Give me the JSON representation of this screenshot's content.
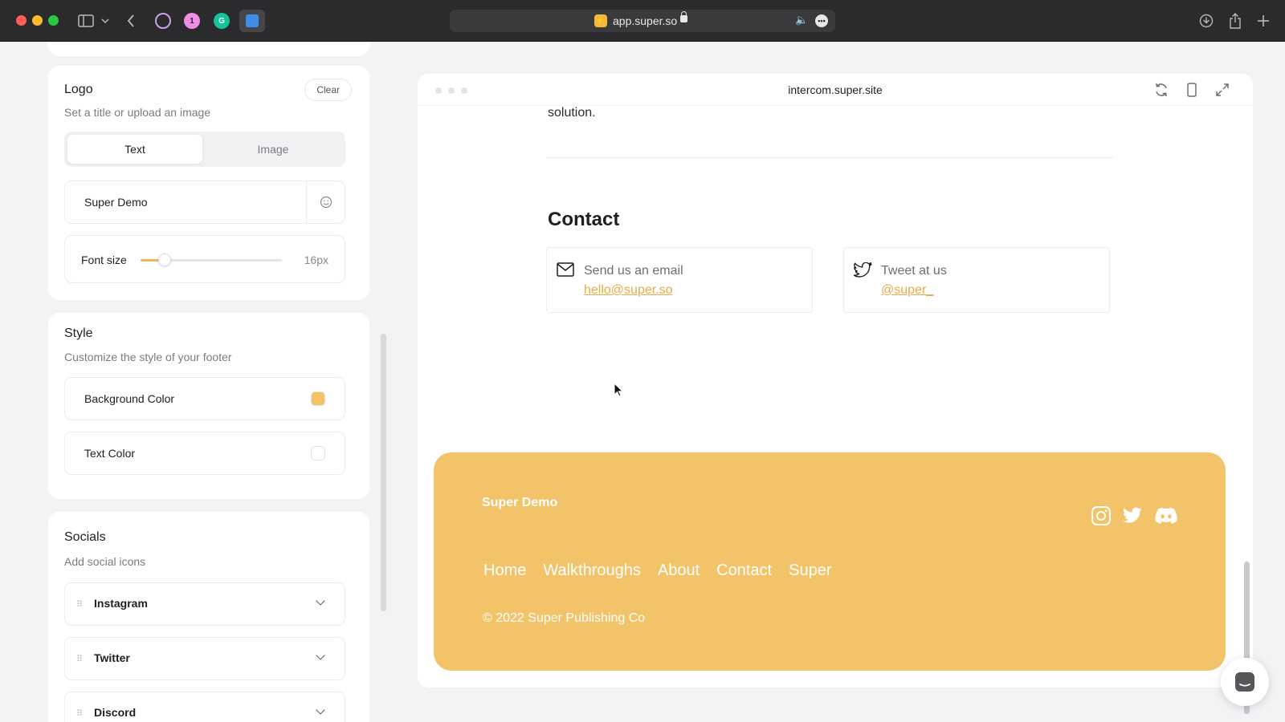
{
  "browser": {
    "url": "app.super.so"
  },
  "editor": {
    "logo": {
      "title": "Logo",
      "subtitle": "Set a title or upload an image",
      "clear_label": "Clear",
      "tabs": [
        "Text",
        "Image"
      ],
      "active_tab": "Text",
      "text_value": "Super Demo",
      "font_size_label": "Font size",
      "font_size_value": "16px",
      "font_size_fraction": 0.16
    },
    "style": {
      "title": "Style",
      "subtitle": "Customize the style of your footer",
      "background_label": "Background Color",
      "background_color": "#f3c369",
      "text_color_label": "Text Color",
      "text_color": "#ffffff"
    },
    "socials": {
      "title": "Socials",
      "subtitle": "Add social icons",
      "items": [
        "Instagram",
        "Twitter",
        "Discord"
      ]
    }
  },
  "preview": {
    "url": "intercom.super.site",
    "partial_text": "solution.",
    "contact_heading": "Contact",
    "email_card": {
      "title": "Send us an email",
      "link": "hello@super.so",
      "icon": "mail-icon"
    },
    "tweet_card": {
      "title": "Tweet at us",
      "link": "@super_",
      "icon": "twitter-icon"
    },
    "footer": {
      "brand": "Super Demo",
      "nav": [
        "Home",
        "Walkthroughs",
        "About",
        "Contact",
        "Super"
      ],
      "copyright": "© 2022 Super Publishing Co",
      "social_icons": [
        "instagram-icon",
        "twitter-icon",
        "discord-icon"
      ]
    }
  },
  "colors": {
    "accent": "#f0b65a",
    "footer_bg": "#f3c369",
    "link": "#e8ab49"
  }
}
